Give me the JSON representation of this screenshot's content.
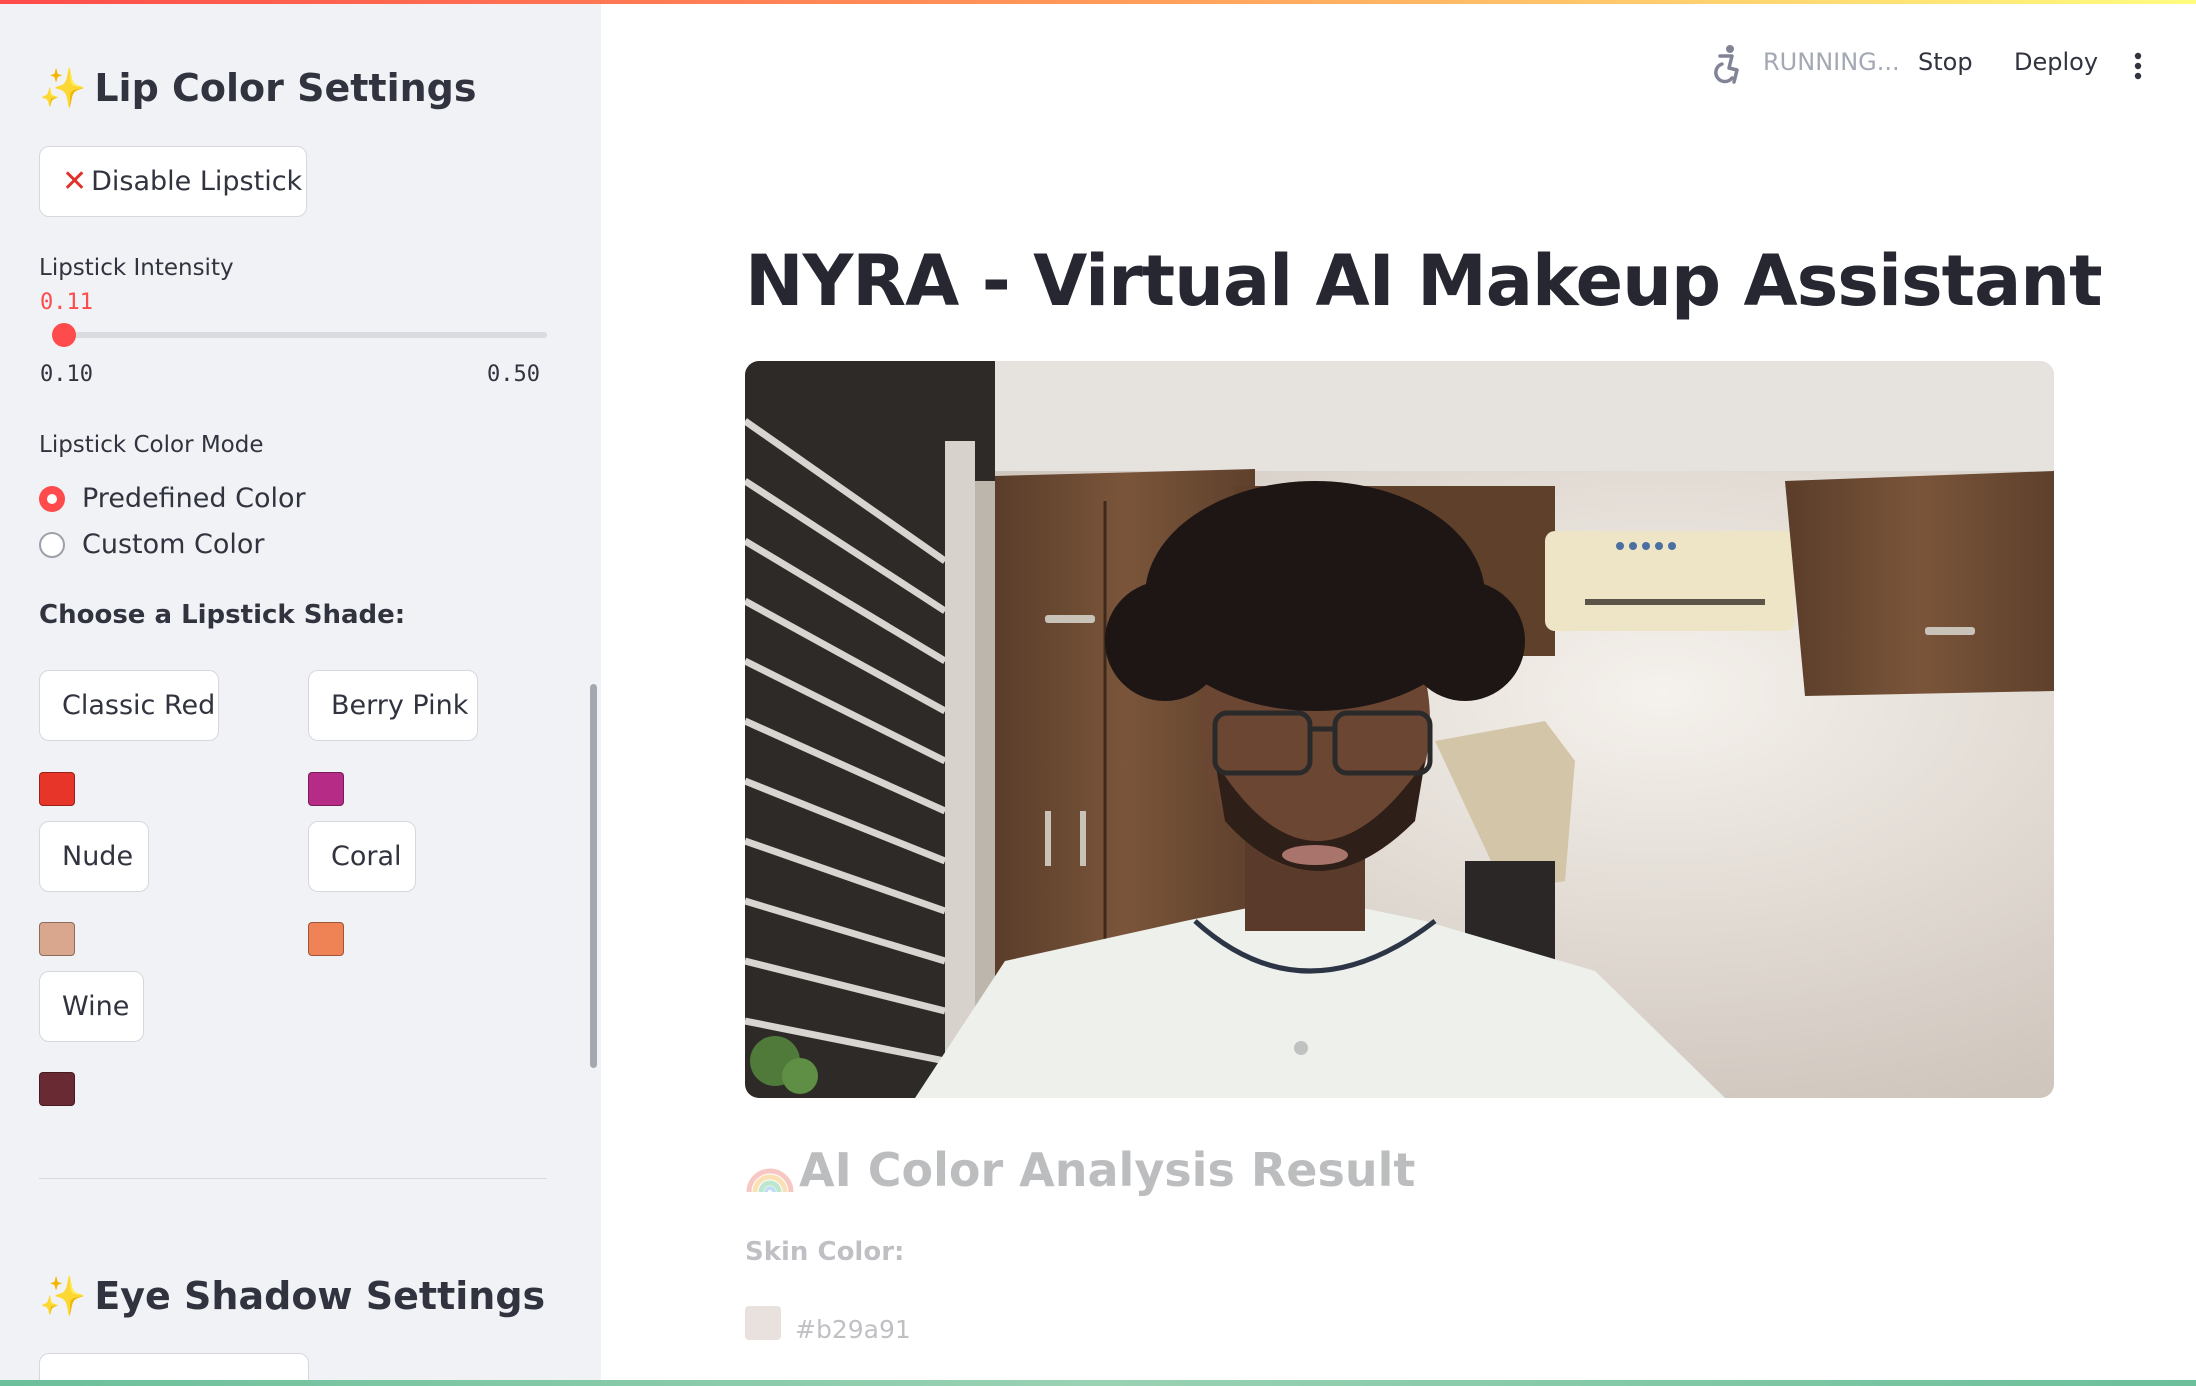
{
  "sidebar": {
    "lip_heading": "Lip Color Settings",
    "disable_lipstick_label": "Disable Lipstick",
    "intensity": {
      "label": "Lipstick Intensity",
      "value": "0.11",
      "min": "0.10",
      "max": "0.50",
      "fraction": 0.025
    },
    "color_mode": {
      "label": "Lipstick Color Mode",
      "options": [
        "Predefined Color",
        "Custom Color"
      ],
      "selected": "Predefined Color"
    },
    "shade_label": "Choose a Lipstick Shade:",
    "shades": [
      {
        "name": "Classic Red",
        "color": "#e8352a"
      },
      {
        "name": "Berry Pink",
        "color": "#b52b86"
      },
      {
        "name": "Nude",
        "color": "#d9a68e"
      },
      {
        "name": "Coral",
        "color": "#ef8355"
      },
      {
        "name": "Wine",
        "color": "#6a2a33"
      }
    ],
    "eye_heading": "Eye Shadow Settings"
  },
  "header": {
    "status": "RUNNING...",
    "stop_label": "Stop",
    "deploy_label": "Deploy"
  },
  "main": {
    "title": "NYRA - Virtual AI Makeup Assistant",
    "result_title": "AI Color Analysis Result",
    "skin_label": "Skin Color:",
    "skin_hex": "#b29a91"
  },
  "colors": {
    "accent": "#ff4b4b",
    "sidebar_bg": "#f0f2f6",
    "text": "#31333f"
  },
  "icons": {
    "sparkle": "✨",
    "cross": "❌",
    "rainbow": "rainbow-icon",
    "running": "running-person-icon",
    "menu": "kebab-menu-icon"
  }
}
